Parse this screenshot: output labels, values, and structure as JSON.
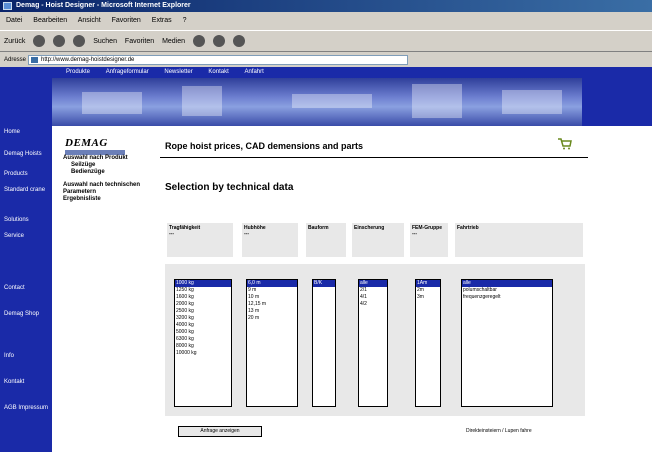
{
  "window": {
    "title": "Demag - Hoist Designer - Microsoft Internet Explorer"
  },
  "menubar": {
    "items": [
      "Datei",
      "Bearbeiten",
      "Ansicht",
      "Favoriten",
      "Extras",
      "?"
    ]
  },
  "toolbar": {
    "items": [
      "Zurück",
      "Suchen",
      "Favoriten",
      "Medien"
    ]
  },
  "address": {
    "label": "Adresse",
    "url": "http://www.demag-hoistdesigner.de"
  },
  "leftnav": {
    "items": [
      "Home",
      "Demag Hoists",
      "Products",
      "Standard crane",
      "Solutions",
      "Service",
      "Contact",
      "Demag Shop",
      "Info",
      "Kontakt",
      "AGB Impressum"
    ]
  },
  "topnav": {
    "items": [
      "Produkte",
      "Anfrageformular",
      "Newsletter",
      "Kontakt",
      "Anfahrt"
    ]
  },
  "logo": {
    "text": "DEMAG"
  },
  "page": {
    "title": "Rope hoist prices, CAD demensions and parts",
    "section": "Selection by technical data"
  },
  "sidemenu": {
    "group1": "Auswahl nach Produkt",
    "sub1": "Seilzüge",
    "sub2": "Bedienzüge",
    "group2": "Auswahl nach technischen Parametern",
    "group3": "Ergebnisliste"
  },
  "columns": {
    "c1": {
      "label": "Tragfähigkeit",
      "sub": "---"
    },
    "c2": {
      "label": "Hubhöhe",
      "sub": "---"
    },
    "c3": {
      "label": "Bauform",
      "sub": ""
    },
    "c4": {
      "label": "Einscherung",
      "sub": ""
    },
    "c5": {
      "label": "FEM-Gruppe",
      "sub": "---"
    },
    "c6": {
      "label": "Fahrtrieb",
      "sub": ""
    }
  },
  "lists": {
    "capacity": [
      "1000 kg",
      "1250 kg",
      "1600 kg",
      "2000 kg",
      "2500 kg",
      "3200 kg",
      "4000 kg",
      "5000 kg",
      "6300 kg",
      "8000 kg",
      "10000 kg"
    ],
    "height": [
      "6,0 m",
      "9 m",
      "10 m",
      "12,15 m",
      "13 m",
      "20 m"
    ],
    "form": [
      "B/K"
    ],
    "reeving": [
      "alle",
      "2/1",
      "4/1",
      "4/2"
    ],
    "fem": [
      "1Am",
      "2m",
      "3m"
    ],
    "drive": [
      "alle",
      "polumschaltbar",
      "frequenzgeregelt"
    ]
  },
  "buttons": {
    "show": "Anfrage anzeigen"
  },
  "footer": {
    "link": "Direkteinsteiern / Lupen fahre"
  }
}
